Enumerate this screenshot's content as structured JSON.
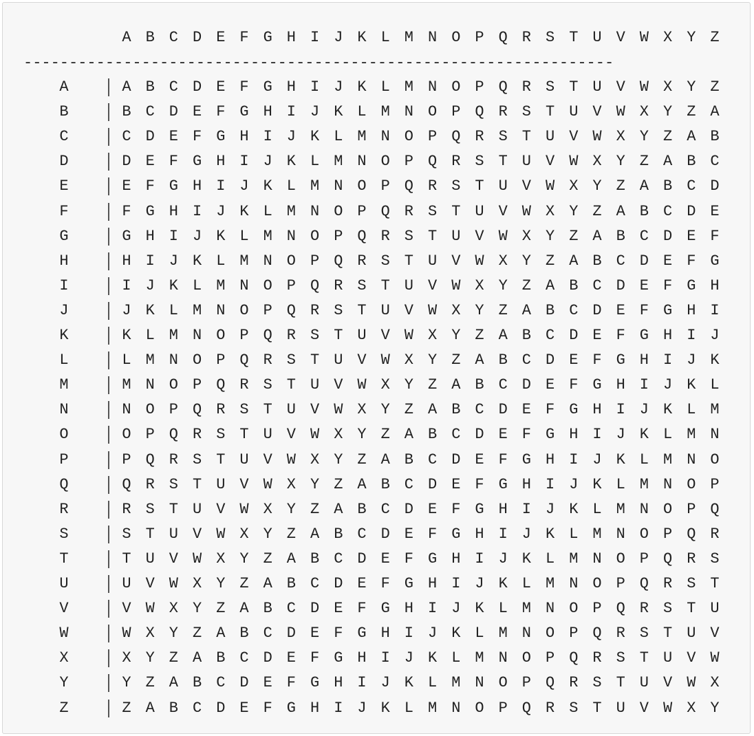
{
  "table": {
    "column_headers": [
      "A",
      "B",
      "C",
      "D",
      "E",
      "F",
      "G",
      "H",
      "I",
      "J",
      "K",
      "L",
      "M",
      "N",
      "O",
      "P",
      "Q",
      "R",
      "S",
      "T",
      "U",
      "V",
      "W",
      "X",
      "Y",
      "Z"
    ],
    "divider": "-----------------------------------------------------------------",
    "rows": [
      {
        "label": "A",
        "cells": [
          "A",
          "B",
          "C",
          "D",
          "E",
          "F",
          "G",
          "H",
          "I",
          "J",
          "K",
          "L",
          "M",
          "N",
          "O",
          "P",
          "Q",
          "R",
          "S",
          "T",
          "U",
          "V",
          "W",
          "X",
          "Y",
          "Z"
        ]
      },
      {
        "label": "B",
        "cells": [
          "B",
          "C",
          "D",
          "E",
          "F",
          "G",
          "H",
          "I",
          "J",
          "K",
          "L",
          "M",
          "N",
          "O",
          "P",
          "Q",
          "R",
          "S",
          "T",
          "U",
          "V",
          "W",
          "X",
          "Y",
          "Z",
          "A"
        ]
      },
      {
        "label": "C",
        "cells": [
          "C",
          "D",
          "E",
          "F",
          "G",
          "H",
          "I",
          "J",
          "K",
          "L",
          "M",
          "N",
          "O",
          "P",
          "Q",
          "R",
          "S",
          "T",
          "U",
          "V",
          "W",
          "X",
          "Y",
          "Z",
          "A",
          "B"
        ]
      },
      {
        "label": "D",
        "cells": [
          "D",
          "E",
          "F",
          "G",
          "H",
          "I",
          "J",
          "K",
          "L",
          "M",
          "N",
          "O",
          "P",
          "Q",
          "R",
          "S",
          "T",
          "U",
          "V",
          "W",
          "X",
          "Y",
          "Z",
          "A",
          "B",
          "C"
        ]
      },
      {
        "label": "E",
        "cells": [
          "E",
          "F",
          "G",
          "H",
          "I",
          "J",
          "K",
          "L",
          "M",
          "N",
          "O",
          "P",
          "Q",
          "R",
          "S",
          "T",
          "U",
          "V",
          "W",
          "X",
          "Y",
          "Z",
          "A",
          "B",
          "C",
          "D"
        ]
      },
      {
        "label": "F",
        "cells": [
          "F",
          "G",
          "H",
          "I",
          "J",
          "K",
          "L",
          "M",
          "N",
          "O",
          "P",
          "Q",
          "R",
          "S",
          "T",
          "U",
          "V",
          "W",
          "X",
          "Y",
          "Z",
          "A",
          "B",
          "C",
          "D",
          "E"
        ]
      },
      {
        "label": "G",
        "cells": [
          "G",
          "H",
          "I",
          "J",
          "K",
          "L",
          "M",
          "N",
          "O",
          "P",
          "Q",
          "R",
          "S",
          "T",
          "U",
          "V",
          "W",
          "X",
          "Y",
          "Z",
          "A",
          "B",
          "C",
          "D",
          "E",
          "F"
        ]
      },
      {
        "label": "H",
        "cells": [
          "H",
          "I",
          "J",
          "K",
          "L",
          "M",
          "N",
          "O",
          "P",
          "Q",
          "R",
          "S",
          "T",
          "U",
          "V",
          "W",
          "X",
          "Y",
          "Z",
          "A",
          "B",
          "C",
          "D",
          "E",
          "F",
          "G"
        ]
      },
      {
        "label": "I",
        "cells": [
          "I",
          "J",
          "K",
          "L",
          "M",
          "N",
          "O",
          "P",
          "Q",
          "R",
          "S",
          "T",
          "U",
          "V",
          "W",
          "X",
          "Y",
          "Z",
          "A",
          "B",
          "C",
          "D",
          "E",
          "F",
          "G",
          "H"
        ]
      },
      {
        "label": "J",
        "cells": [
          "J",
          "K",
          "L",
          "M",
          "N",
          "O",
          "P",
          "Q",
          "R",
          "S",
          "T",
          "U",
          "V",
          "W",
          "X",
          "Y",
          "Z",
          "A",
          "B",
          "C",
          "D",
          "E",
          "F",
          "G",
          "H",
          "I"
        ]
      },
      {
        "label": "K",
        "cells": [
          "K",
          "L",
          "M",
          "N",
          "O",
          "P",
          "Q",
          "R",
          "S",
          "T",
          "U",
          "V",
          "W",
          "X",
          "Y",
          "Z",
          "A",
          "B",
          "C",
          "D",
          "E",
          "F",
          "G",
          "H",
          "I",
          "J"
        ]
      },
      {
        "label": "L",
        "cells": [
          "L",
          "M",
          "N",
          "O",
          "P",
          "Q",
          "R",
          "S",
          "T",
          "U",
          "V",
          "W",
          "X",
          "Y",
          "Z",
          "A",
          "B",
          "C",
          "D",
          "E",
          "F",
          "G",
          "H",
          "I",
          "J",
          "K"
        ]
      },
      {
        "label": "M",
        "cells": [
          "M",
          "N",
          "O",
          "P",
          "Q",
          "R",
          "S",
          "T",
          "U",
          "V",
          "W",
          "X",
          "Y",
          "Z",
          "A",
          "B",
          "C",
          "D",
          "E",
          "F",
          "G",
          "H",
          "I",
          "J",
          "K",
          "L"
        ]
      },
      {
        "label": "N",
        "cells": [
          "N",
          "O",
          "P",
          "Q",
          "R",
          "S",
          "T",
          "U",
          "V",
          "W",
          "X",
          "Y",
          "Z",
          "A",
          "B",
          "C",
          "D",
          "E",
          "F",
          "G",
          "H",
          "I",
          "J",
          "K",
          "L",
          "M"
        ]
      },
      {
        "label": "O",
        "cells": [
          "O",
          "P",
          "Q",
          "R",
          "S",
          "T",
          "U",
          "V",
          "W",
          "X",
          "Y",
          "Z",
          "A",
          "B",
          "C",
          "D",
          "E",
          "F",
          "G",
          "H",
          "I",
          "J",
          "K",
          "L",
          "M",
          "N"
        ]
      },
      {
        "label": "P",
        "cells": [
          "P",
          "Q",
          "R",
          "S",
          "T",
          "U",
          "V",
          "W",
          "X",
          "Y",
          "Z",
          "A",
          "B",
          "C",
          "D",
          "E",
          "F",
          "G",
          "H",
          "I",
          "J",
          "K",
          "L",
          "M",
          "N",
          "O"
        ]
      },
      {
        "label": "Q",
        "cells": [
          "Q",
          "R",
          "S",
          "T",
          "U",
          "V",
          "W",
          "X",
          "Y",
          "Z",
          "A",
          "B",
          "C",
          "D",
          "E",
          "F",
          "G",
          "H",
          "I",
          "J",
          "K",
          "L",
          "M",
          "N",
          "O",
          "P"
        ]
      },
      {
        "label": "R",
        "cells": [
          "R",
          "S",
          "T",
          "U",
          "V",
          "W",
          "X",
          "Y",
          "Z",
          "A",
          "B",
          "C",
          "D",
          "E",
          "F",
          "G",
          "H",
          "I",
          "J",
          "K",
          "L",
          "M",
          "N",
          "O",
          "P",
          "Q"
        ]
      },
      {
        "label": "S",
        "cells": [
          "S",
          "T",
          "U",
          "V",
          "W",
          "X",
          "Y",
          "Z",
          "A",
          "B",
          "C",
          "D",
          "E",
          "F",
          "G",
          "H",
          "I",
          "J",
          "K",
          "L",
          "M",
          "N",
          "O",
          "P",
          "Q",
          "R"
        ]
      },
      {
        "label": "T",
        "cells": [
          "T",
          "U",
          "V",
          "W",
          "X",
          "Y",
          "Z",
          "A",
          "B",
          "C",
          "D",
          "E",
          "F",
          "G",
          "H",
          "I",
          "J",
          "K",
          "L",
          "M",
          "N",
          "O",
          "P",
          "Q",
          "R",
          "S"
        ]
      },
      {
        "label": "U",
        "cells": [
          "U",
          "V",
          "W",
          "X",
          "Y",
          "Z",
          "A",
          "B",
          "C",
          "D",
          "E",
          "F",
          "G",
          "H",
          "I",
          "J",
          "K",
          "L",
          "M",
          "N",
          "O",
          "P",
          "Q",
          "R",
          "S",
          "T"
        ]
      },
      {
        "label": "V",
        "cells": [
          "V",
          "W",
          "X",
          "Y",
          "Z",
          "A",
          "B",
          "C",
          "D",
          "E",
          "F",
          "G",
          "H",
          "I",
          "J",
          "K",
          "L",
          "M",
          "N",
          "O",
          "P",
          "Q",
          "R",
          "S",
          "T",
          "U"
        ]
      },
      {
        "label": "W",
        "cells": [
          "W",
          "X",
          "Y",
          "Z",
          "A",
          "B",
          "C",
          "D",
          "E",
          "F",
          "G",
          "H",
          "I",
          "J",
          "K",
          "L",
          "M",
          "N",
          "O",
          "P",
          "Q",
          "R",
          "S",
          "T",
          "U",
          "V"
        ]
      },
      {
        "label": "X",
        "cells": [
          "X",
          "Y",
          "Z",
          "A",
          "B",
          "C",
          "D",
          "E",
          "F",
          "G",
          "H",
          "I",
          "J",
          "K",
          "L",
          "M",
          "N",
          "O",
          "P",
          "Q",
          "R",
          "S",
          "T",
          "U",
          "V",
          "W"
        ]
      },
      {
        "label": "Y",
        "cells": [
          "Y",
          "Z",
          "A",
          "B",
          "C",
          "D",
          "E",
          "F",
          "G",
          "H",
          "I",
          "J",
          "K",
          "L",
          "M",
          "N",
          "O",
          "P",
          "Q",
          "R",
          "S",
          "T",
          "U",
          "V",
          "W",
          "X"
        ]
      },
      {
        "label": "Z",
        "cells": [
          "Z",
          "A",
          "B",
          "C",
          "D",
          "E",
          "F",
          "G",
          "H",
          "I",
          "J",
          "K",
          "L",
          "M",
          "N",
          "O",
          "P",
          "Q",
          "R",
          "S",
          "T",
          "U",
          "V",
          "W",
          "X",
          "Y"
        ]
      }
    ]
  }
}
